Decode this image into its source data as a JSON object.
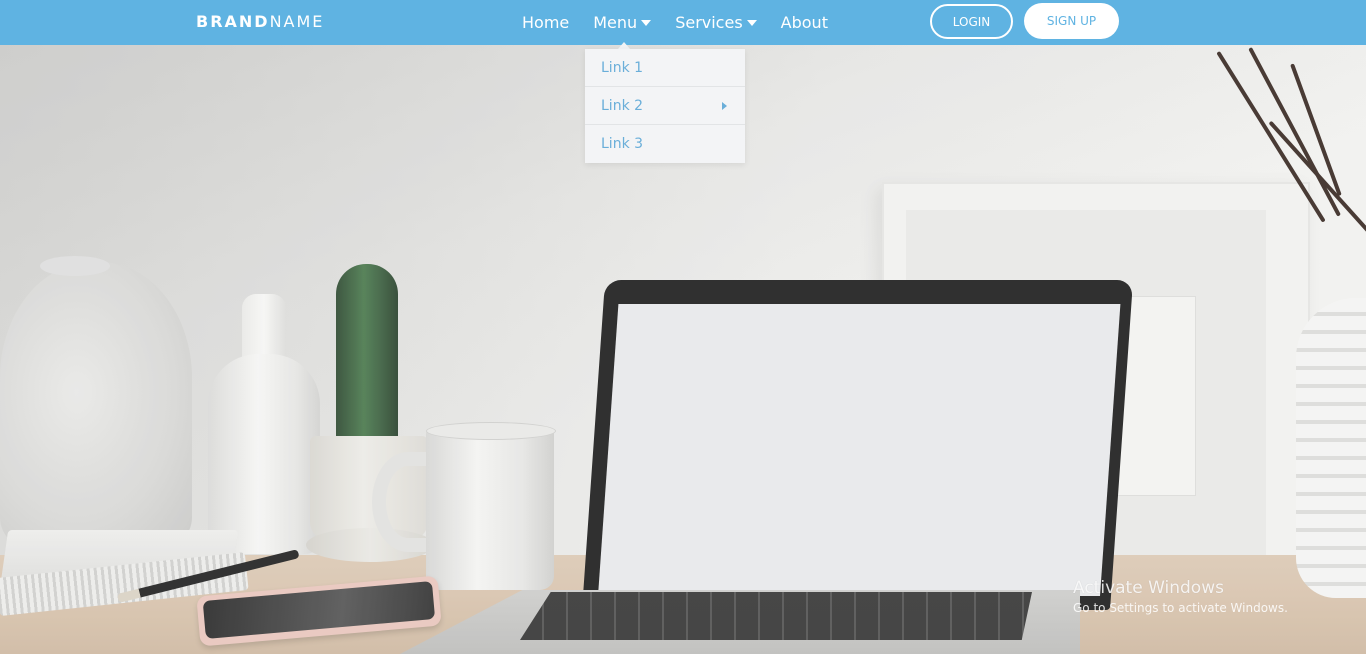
{
  "navbar": {
    "brand_bold": "BRAND",
    "brand_light": "NAME",
    "links": [
      {
        "label": "Home",
        "has_caret": false
      },
      {
        "label": "Menu",
        "has_caret": true
      },
      {
        "label": "Services",
        "has_caret": true
      },
      {
        "label": "About",
        "has_caret": false
      }
    ],
    "login_label": "LOGIN",
    "signup_label": "SIGN UP",
    "background_color": "#5fb3e2"
  },
  "dropdown": {
    "open_menu": "Menu",
    "items": [
      {
        "label": "Link 1",
        "has_submenu": false
      },
      {
        "label": "Link 2",
        "has_submenu": true
      },
      {
        "label": "Link 3",
        "has_submenu": false
      }
    ],
    "text_color": "#6aaed9"
  },
  "watermark": {
    "title": "Activate Windows",
    "subtitle": "Go to Settings to activate Windows."
  }
}
